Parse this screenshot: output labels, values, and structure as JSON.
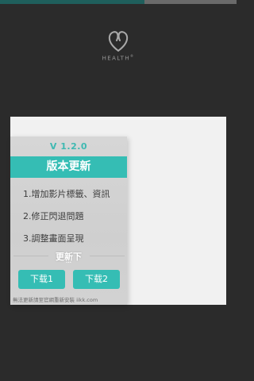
{
  "progress": {
    "value_percent": 61,
    "fill_color": "#1f5f5c",
    "track_color": "#6a6a6a"
  },
  "logo": {
    "icon": "heart-drop-icon",
    "text": "HEALTH",
    "mark": "®"
  },
  "dialog": {
    "version": "V 1.2.0",
    "title": "版本更新",
    "changes": [
      "1.增加影片標籤、資訊",
      "2.修正閃退問題",
      "3.調整畫面呈現"
    ],
    "update_label": "更新下",
    "update_dots": "•••",
    "download_1": "下载1",
    "download_2": "下载2",
    "footer": "無法更新請至官網重新安裝 iikk.com",
    "accent_color": "#35bdb4"
  }
}
